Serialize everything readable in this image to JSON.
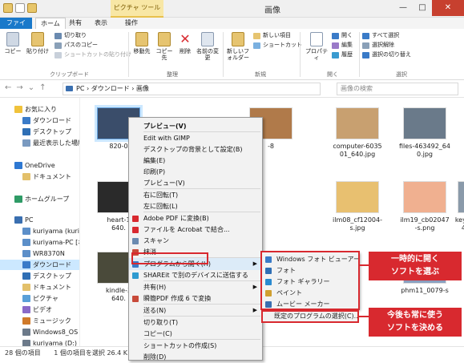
{
  "titlebar": {
    "context_tab": "ピクチャ ツール",
    "title": "画像",
    "buttons": [
      "—",
      "□",
      "✕"
    ]
  },
  "tabs": {
    "file": "ファイル",
    "home": "ホーム",
    "share": "共有",
    "view": "表示",
    "manage": "操作"
  },
  "ribbon": {
    "copy": "コピー",
    "paste": "貼り付け",
    "cut": "切り取り",
    "copy_path": "パスのコピー",
    "paste_shortcut": "ショートカットの貼り付け",
    "move_to": "移動先",
    "copy_to": "コピー先",
    "delete": "削除",
    "rename": "名前の変更",
    "new_folder": "新しいフォルダー",
    "new_item": "新しい項目",
    "shortcut": "ショートカット",
    "properties": "プロパティ",
    "open": "開く",
    "edit": "編集",
    "history": "履歴",
    "select_all": "すべて選択",
    "select_none": "選択解除",
    "invert_selection": "選択の切り替え",
    "groups": {
      "clipboard": "クリップボード",
      "organize": "整理",
      "new": "新規",
      "open": "開く",
      "select": "選択"
    }
  },
  "address": {
    "path": "PC › ダウンロード › 画像",
    "search_placeholder": "画像の検索"
  },
  "sidebar": {
    "items": [
      {
        "label": "お気に入り",
        "color": "#f0c23b"
      },
      {
        "label": "ダウンロード",
        "color": "#3a7bc8"
      },
      {
        "label": "デスクトップ",
        "color": "#2f6fb5"
      },
      {
        "label": "最近表示した場所",
        "color": "#7a9ac0"
      },
      {
        "label": "OneDrive",
        "color": "#2e78d2"
      },
      {
        "label": "ドキュメント",
        "color": "#e3c06a"
      },
      {
        "label": "ホームグループ",
        "color": "#2f9b66"
      },
      {
        "label": "PC",
        "color": "#3a6fb0"
      },
      {
        "label": "kuriyama (kuriya",
        "color": "#5c8fc9"
      },
      {
        "label": "kuriyama-PC [ホ",
        "color": "#5c8fc9"
      },
      {
        "label": "WR8370N",
        "color": "#5c8fc9"
      },
      {
        "label": "ダウンロード",
        "color": "#3a7bc8"
      },
      {
        "label": "デスクトップ",
        "color": "#2f6fb5"
      },
      {
        "label": "ドキュメント",
        "color": "#e3c06a"
      },
      {
        "label": "ピクチャ",
        "color": "#5aa0d8"
      },
      {
        "label": "ビデオ",
        "color": "#8a6ac8"
      },
      {
        "label": "ミュージック",
        "color": "#d07a2a"
      },
      {
        "label": "Windows8_OS (",
        "color": "#6c7a8a"
      },
      {
        "label": "kuriyama (D:)",
        "color": "#6c7a8a"
      }
    ]
  },
  "files": [
    {
      "name": "820-0",
      "color": "#3a4d6a"
    },
    {
      "name": "-8",
      "color": "#b07a4a"
    },
    {
      "name": "computer-6035\n01_640.jpg",
      "color": "#c8a070"
    },
    {
      "name": "files-463492_64\n0.jpg",
      "color": "#6a7a8a"
    },
    {
      "name": "gum01_ph0100\n5-s (1).jpg",
      "color": "#9a6a4a"
    },
    {
      "name": "heart-1\n640.",
      "color": "#2a2a2a"
    },
    {
      "name": "ilm08_cf12004-\ns.jpg",
      "color": "#e8c070"
    },
    {
      "name": "ilm19_cb02047\n-s.png",
      "color": "#f0b090"
    },
    {
      "name": "keyboard-2864\n42_640.jpg",
      "color": "#8a9aaa"
    },
    {
      "name": "kindle-3\n640.",
      "color": "#4a4a3a"
    },
    {
      "name": "phm11_0079-s",
      "color": "#8aa0c0"
    }
  ],
  "context_menu": {
    "items": [
      {
        "label": "プレビュー(V)",
        "bold": true
      },
      {
        "label": "Edit with GIMP"
      },
      {
        "label": "デスクトップの背景として設定(B)"
      },
      {
        "label": "編集(E)"
      },
      {
        "label": "印刷(P)"
      },
      {
        "label": "プレビュー(V)"
      },
      {
        "label": "右に回転(T)"
      },
      {
        "label": "左に回転(L)"
      },
      {
        "label": "Adobe PDF に変換(B)"
      },
      {
        "label": "ファイルを Acrobat で結合..."
      },
      {
        "label": "スキャン"
      },
      {
        "label": "抹消"
      },
      {
        "label": "プログラムから開く(H)"
      },
      {
        "label": "SHAREit で別のデバイスに送信する"
      },
      {
        "label": "共有(H)"
      },
      {
        "label": "瞬簡PDF 作成 6 で変換"
      },
      {
        "label": "送る(N)"
      },
      {
        "label": "切り取り(T)"
      },
      {
        "label": "コピー(C)"
      },
      {
        "label": "ショートカットの作成(S)"
      },
      {
        "label": "削除(D)"
      }
    ]
  },
  "submenu": {
    "items": [
      {
        "label": "Windows フォト ビューアー"
      },
      {
        "label": "フォト"
      },
      {
        "label": "フォト ギャラリー"
      },
      {
        "label": "ペイント"
      },
      {
        "label": "ムービー メーカー"
      }
    ],
    "choose": "既定のプログラムの選択(C)..."
  },
  "callouts": {
    "one_time": [
      "一時的に開く",
      "ソフトを選ぶ"
    ],
    "always": [
      "今後も常に使う",
      "ソフトを決める"
    ]
  },
  "status": {
    "count": "28 個の項目",
    "selected": "1 個の項目を選択 26.4 K"
  },
  "colors": {
    "accent": "#1979ca",
    "highlight": "#d8292f"
  }
}
